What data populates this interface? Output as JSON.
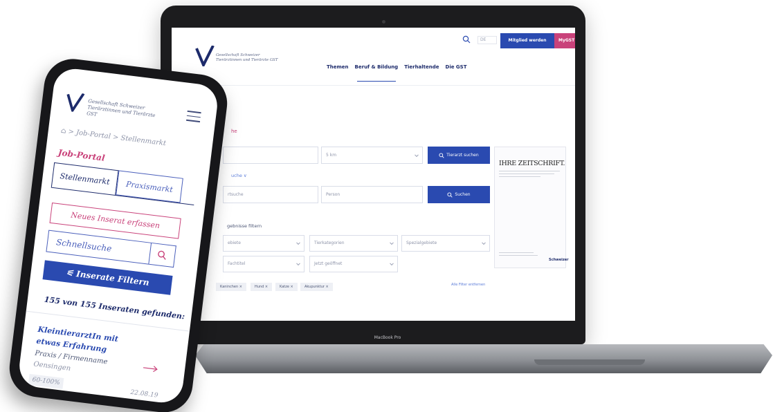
{
  "laptop": {
    "brand": "MacBook Pro",
    "lang": "DE",
    "member_button": "Mitglied werden",
    "mygst_button": "MyGST",
    "logo_text": "Gesellschaft Schweizer Tierärztinnen und Tierärzte GST",
    "nav": [
      "Themen",
      "Beruf & Bildung",
      "Tierhaltende",
      "Die GST"
    ],
    "pink_fragment": "he",
    "distance_value": "5 km",
    "vet_search_button": "Tierarzt suchen",
    "extended_search": "uche",
    "freetext_placeholder": "rtsuche",
    "person_placeholder": "Person",
    "search_button": "Suchen",
    "filter_heading": "gebnisse filtern",
    "filters_row1": [
      "ebiete",
      "Tierkategorien",
      "Spezialgebiete"
    ],
    "filters_row2": [
      "Fachtitel",
      "Jetzt geöffnet"
    ],
    "chips": [
      "Kaninchen",
      "Hund",
      "Katze",
      "Akupunktur"
    ],
    "clear_filters": "Alle Filter entfernen",
    "ad_title": "IHRE ZEITSCHRIFT.",
    "ad_logo": "Schweizer"
  },
  "phone": {
    "logo_text": "Gesellschaft Schweizer Tierärztinnen und Tierärzte GST",
    "breadcrumb": "⌂ > Job-Portal > Stellenmarkt",
    "portal_title": "Job-Portal",
    "tabs": [
      "Stellenmarkt",
      "Praxismarkt"
    ],
    "new_ad_button": "Neues Inserat erfassen",
    "quick_search_placeholder": "Schnellsuche",
    "filter_button": "Inserate Filtern",
    "result_count": "155 von 155 Inseraten gefunden:",
    "job_title": "KleintierarztIn mit etwas Erfahrung",
    "company": "Praxis / Firmenname",
    "location": "Oensingen",
    "workload": "60-100%",
    "date": "22.08.19"
  },
  "colors": {
    "brand_blue": "#2a4ab0",
    "brand_navy": "#1d2b6b",
    "brand_pink": "#c9427a"
  }
}
